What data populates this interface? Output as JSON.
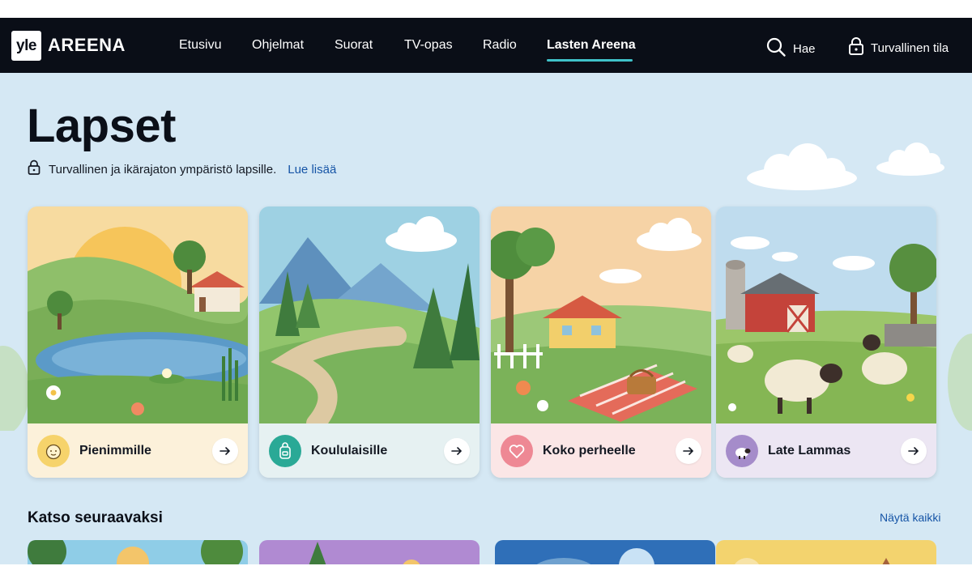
{
  "header": {
    "logo_mark": "yle",
    "logo_text": "AREENA",
    "nav": [
      {
        "label": "Etusivu"
      },
      {
        "label": "Ohjelmat"
      },
      {
        "label": "Suorat"
      },
      {
        "label": "TV-opas"
      },
      {
        "label": "Radio"
      },
      {
        "label": "Lasten Areena",
        "active": true
      }
    ],
    "search_label": "Hae",
    "safe_mode_label": "Turvallinen tila",
    "accent_color": "#3fc2c9"
  },
  "hero": {
    "title": "Lapset",
    "safety_text": "Turvallinen ja ikärajaton ympäristö lapsille.",
    "read_more": "Lue lisää"
  },
  "categories": [
    {
      "label": "Pienimmille",
      "icon": "baby-face-icon",
      "footer_color": "#fcf1da",
      "icon_color": "#f6d36b"
    },
    {
      "label": "Koululaisille",
      "icon": "backpack-icon",
      "footer_color": "#e6f1f2",
      "icon_color": "#2aa996"
    },
    {
      "label": "Koko perheelle",
      "icon": "heart-icon",
      "footer_color": "#fbe6e6",
      "icon_color": "#ee8894"
    },
    {
      "label": "Late Lammas",
      "icon": "sheep-icon",
      "footer_color": "#ece6f3",
      "icon_color": "#a58cca"
    }
  ],
  "next_section": {
    "title": "Katso seuraavaksi",
    "show_all": "Näytä kaikki"
  }
}
